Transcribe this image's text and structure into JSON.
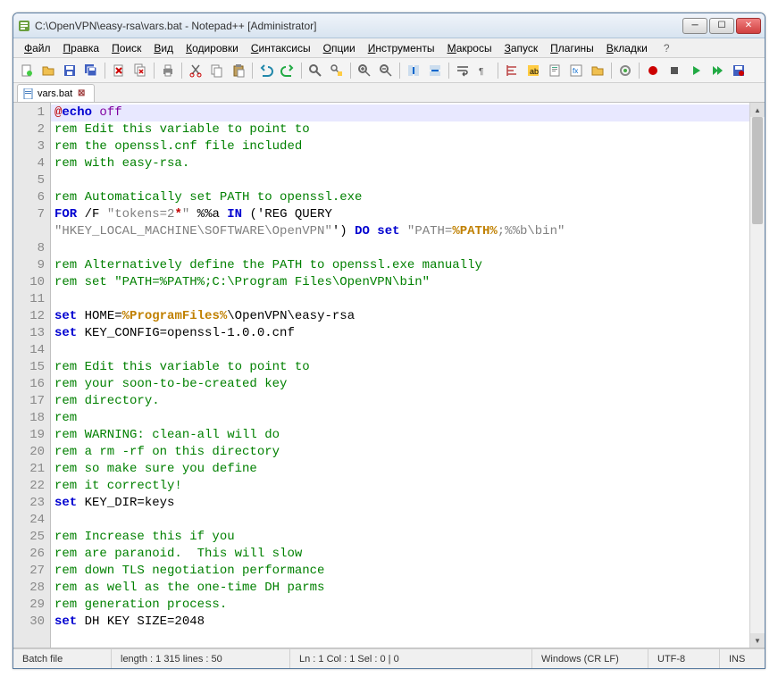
{
  "window": {
    "title": "C:\\OpenVPN\\easy-rsa\\vars.bat - Notepad++ [Administrator]"
  },
  "menu": {
    "items": [
      {
        "label": "Файл",
        "ul": "Ф"
      },
      {
        "label": "Правка",
        "ul": "П"
      },
      {
        "label": "Поиск",
        "ul": "П"
      },
      {
        "label": "Вид",
        "ul": "В"
      },
      {
        "label": "Кодировки",
        "ul": "К"
      },
      {
        "label": "Синтаксисы",
        "ul": "С"
      },
      {
        "label": "Опции",
        "ul": "О"
      },
      {
        "label": "Инструменты",
        "ul": "И"
      },
      {
        "label": "Макросы",
        "ul": "М"
      },
      {
        "label": "Запуск",
        "ul": "З"
      },
      {
        "label": "Плагины",
        "ul": "П"
      },
      {
        "label": "Вкладки",
        "ul": "В"
      }
    ],
    "extra": "?"
  },
  "toolbar_icons": [
    "new-file",
    "open-file",
    "save",
    "save-all",
    "sep",
    "close",
    "close-all",
    "sep",
    "print",
    "sep",
    "cut",
    "copy",
    "paste",
    "sep",
    "undo",
    "redo",
    "sep",
    "find",
    "replace",
    "sep",
    "zoom-in",
    "zoom-out",
    "sep",
    "sync-v",
    "sync-h",
    "sep",
    "word-wrap",
    "show-all",
    "sep",
    "indent-guide",
    "lang",
    "doc-map",
    "func-list",
    "folder",
    "sep",
    "monitor",
    "sep",
    "record",
    "stop",
    "play",
    "play-multi",
    "save-macro"
  ],
  "tab": {
    "label": "vars.bat"
  },
  "code_lines": [
    {
      "n": 1,
      "html": "<span class='c-at'>@</span><span class='c-kw'>echo</span> <span class='c-cmd'>off</span>",
      "current": true
    },
    {
      "n": 2,
      "html": "<span class='c-rem'>rem Edit this variable to point to</span>"
    },
    {
      "n": 3,
      "html": "<span class='c-rem'>rem the openssl.cnf file included</span>"
    },
    {
      "n": 4,
      "html": "<span class='c-rem'>rem with easy-rsa.</span>"
    },
    {
      "n": 5,
      "html": ""
    },
    {
      "n": 6,
      "html": "<span class='c-rem'>rem Automatically set PATH to openssl.exe</span>"
    },
    {
      "n": 7,
      "html": "<span class='c-kw'>FOR</span> /F <span class='c-str'>\"tokens=2</span><span class='c-op'>*</span><span class='c-str'>\"</span> %%a <span class='c-kw'>IN</span> ('REG QUERY <span class='c-str'>\"HKEY_LOCAL_MACHINE\\SOFTWARE\\OpenVPN\"</span>') <span class='c-kw'>DO</span> <span class='c-kw'>set</span> <span class='c-str'>\"PATH=</span><span class='c-var'>%PATH%</span><span class='c-str'>;%%b\\bin\"</span>"
    },
    {
      "n": 8,
      "html": ""
    },
    {
      "n": 9,
      "html": "<span class='c-rem'>rem Alternatively define the PATH to openssl.exe manually</span>"
    },
    {
      "n": 10,
      "html": "<span class='c-rem'>rem set \"PATH=%PATH%;C:\\Program Files\\OpenVPN\\bin\"</span>"
    },
    {
      "n": 11,
      "html": ""
    },
    {
      "n": 12,
      "html": "<span class='c-kw'>set</span> HOME=<span class='c-var'>%ProgramFiles%</span>\\OpenVPN\\easy-rsa"
    },
    {
      "n": 13,
      "html": "<span class='c-kw'>set</span> KEY_CONFIG=openssl-1.0.0.cnf"
    },
    {
      "n": 14,
      "html": ""
    },
    {
      "n": 15,
      "html": "<span class='c-rem'>rem Edit this variable to point to</span>"
    },
    {
      "n": 16,
      "html": "<span class='c-rem'>rem your soon-to-be-created key</span>"
    },
    {
      "n": 17,
      "html": "<span class='c-rem'>rem directory.</span>"
    },
    {
      "n": 18,
      "html": "<span class='c-rem'>rem</span>"
    },
    {
      "n": 19,
      "html": "<span class='c-rem'>rem WARNING: clean-all will do</span>"
    },
    {
      "n": 20,
      "html": "<span class='c-rem'>rem a rm -rf on this directory</span>"
    },
    {
      "n": 21,
      "html": "<span class='c-rem'>rem so make sure you define</span>"
    },
    {
      "n": 22,
      "html": "<span class='c-rem'>rem it correctly!</span>"
    },
    {
      "n": 23,
      "html": "<span class='c-kw'>set</span> KEY_DIR=keys"
    },
    {
      "n": 24,
      "html": ""
    },
    {
      "n": 25,
      "html": "<span class='c-rem'>rem Increase this if you</span>"
    },
    {
      "n": 26,
      "html": "<span class='c-rem'>rem are paranoid.  This will slow</span>"
    },
    {
      "n": 27,
      "html": "<span class='c-rem'>rem down TLS negotiation performance</span>"
    },
    {
      "n": 28,
      "html": "<span class='c-rem'>rem as well as the one-time DH parms</span>"
    },
    {
      "n": 29,
      "html": "<span class='c-rem'>rem generation process.</span>"
    },
    {
      "n": 30,
      "html": "<span class='c-kw'>set</span> DH KEY SIZE=2048"
    }
  ],
  "status": {
    "filetype": "Batch file",
    "length": "length : 1 315    lines : 50",
    "pos": "Ln : 1   Col : 1   Sel : 0 | 0",
    "eol": "Windows (CR LF)",
    "enc": "UTF-8",
    "ins": "INS"
  }
}
